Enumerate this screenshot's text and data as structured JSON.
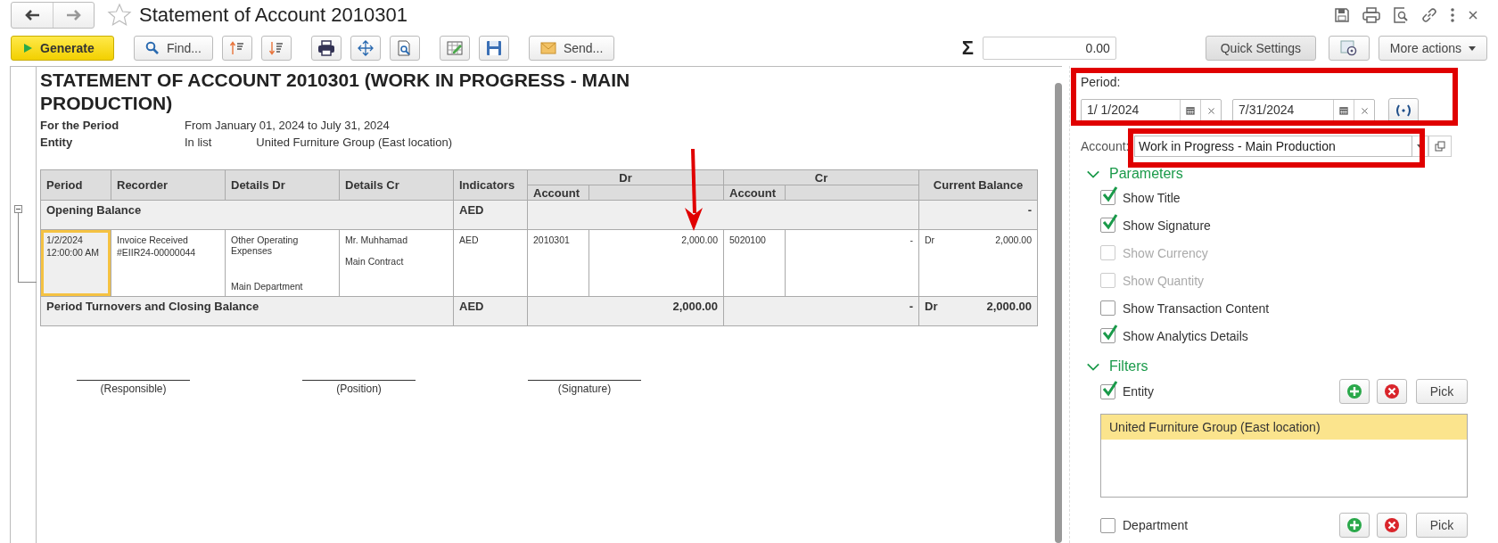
{
  "window": {
    "title": "Statement of Account 2010301"
  },
  "toolbar": {
    "generate": "Generate",
    "find": "Find...",
    "send": "Send...",
    "sum_symbol": "Σ",
    "sum": "0.00",
    "quick_settings": "Quick Settings",
    "more_actions": "More actions"
  },
  "report": {
    "title": "STATEMENT OF ACCOUNT 2010301 (WORK IN PROGRESS - MAIN PRODUCTION)",
    "info": [
      {
        "label": "For the Period",
        "values": [
          "From January 01, 2024 to July 31, 2024"
        ]
      },
      {
        "label": "Entity",
        "values": [
          "In list",
          "United Furniture Group (East location)"
        ]
      }
    ],
    "columns": [
      "Period",
      "Recorder",
      "Details Dr",
      "Details Cr",
      "Indicators"
    ],
    "groups": [
      {
        "label": "Dr",
        "sub": "Account"
      },
      {
        "label": "Cr",
        "sub": "Account"
      }
    ],
    "balance_column": "Current Balance",
    "rows": [
      {
        "kind": "opening",
        "label": "Opening Balance",
        "indicator": "AED",
        "balance": "-"
      },
      {
        "kind": "entry",
        "selected": true,
        "period": [
          "1/2/2024",
          "12:00:00 AM"
        ],
        "recorder": [
          "Invoice Received",
          "#EIIR24-00000044"
        ],
        "details_dr": [
          "Other Operating Expenses",
          "Main Department"
        ],
        "details_cr": [
          "Mr. Muhhamad",
          "Main Contract"
        ],
        "indicator": "AED",
        "dr_account": "2010301",
        "dr_amount": "2,000.00",
        "cr_account": "5020100",
        "cr_amount": "-",
        "balance_side": "Dr",
        "balance": "2,000.00"
      },
      {
        "kind": "closing",
        "label": "Period Turnovers and Closing Balance",
        "indicator": "AED",
        "dr_amount": "2,000.00",
        "cr_amount": "-",
        "balance_side": "Dr",
        "balance": "2,000.00"
      }
    ],
    "signatures": [
      "(Responsible)",
      "(Position)",
      "(Signature)"
    ]
  },
  "settings": {
    "period_label": "Period:",
    "date_from": "1/ 1/2024",
    "date_to": "7/31/2024",
    "account_label": "Account:",
    "account": "Work in Progress - Main Production",
    "parameters_title": "Parameters",
    "parameters": [
      {
        "label": "Show Title",
        "checked": true,
        "disabled": false
      },
      {
        "label": "Show Signature",
        "checked": true,
        "disabled": false
      },
      {
        "label": "Show Currency",
        "checked": false,
        "disabled": true
      },
      {
        "label": "Show Quantity",
        "checked": false,
        "disabled": true
      },
      {
        "label": "Show Transaction Content",
        "checked": false,
        "disabled": false
      },
      {
        "label": "Show Analytics Details",
        "checked": true,
        "disabled": false
      }
    ],
    "filters_title": "Filters",
    "filters": [
      {
        "label": "Entity",
        "checked": true,
        "pick": "Pick",
        "values": [
          {
            "text": "United Furniture Group (East location)",
            "selected": true
          }
        ]
      },
      {
        "label": "Department",
        "checked": false,
        "pick": "Pick"
      }
    ]
  }
}
